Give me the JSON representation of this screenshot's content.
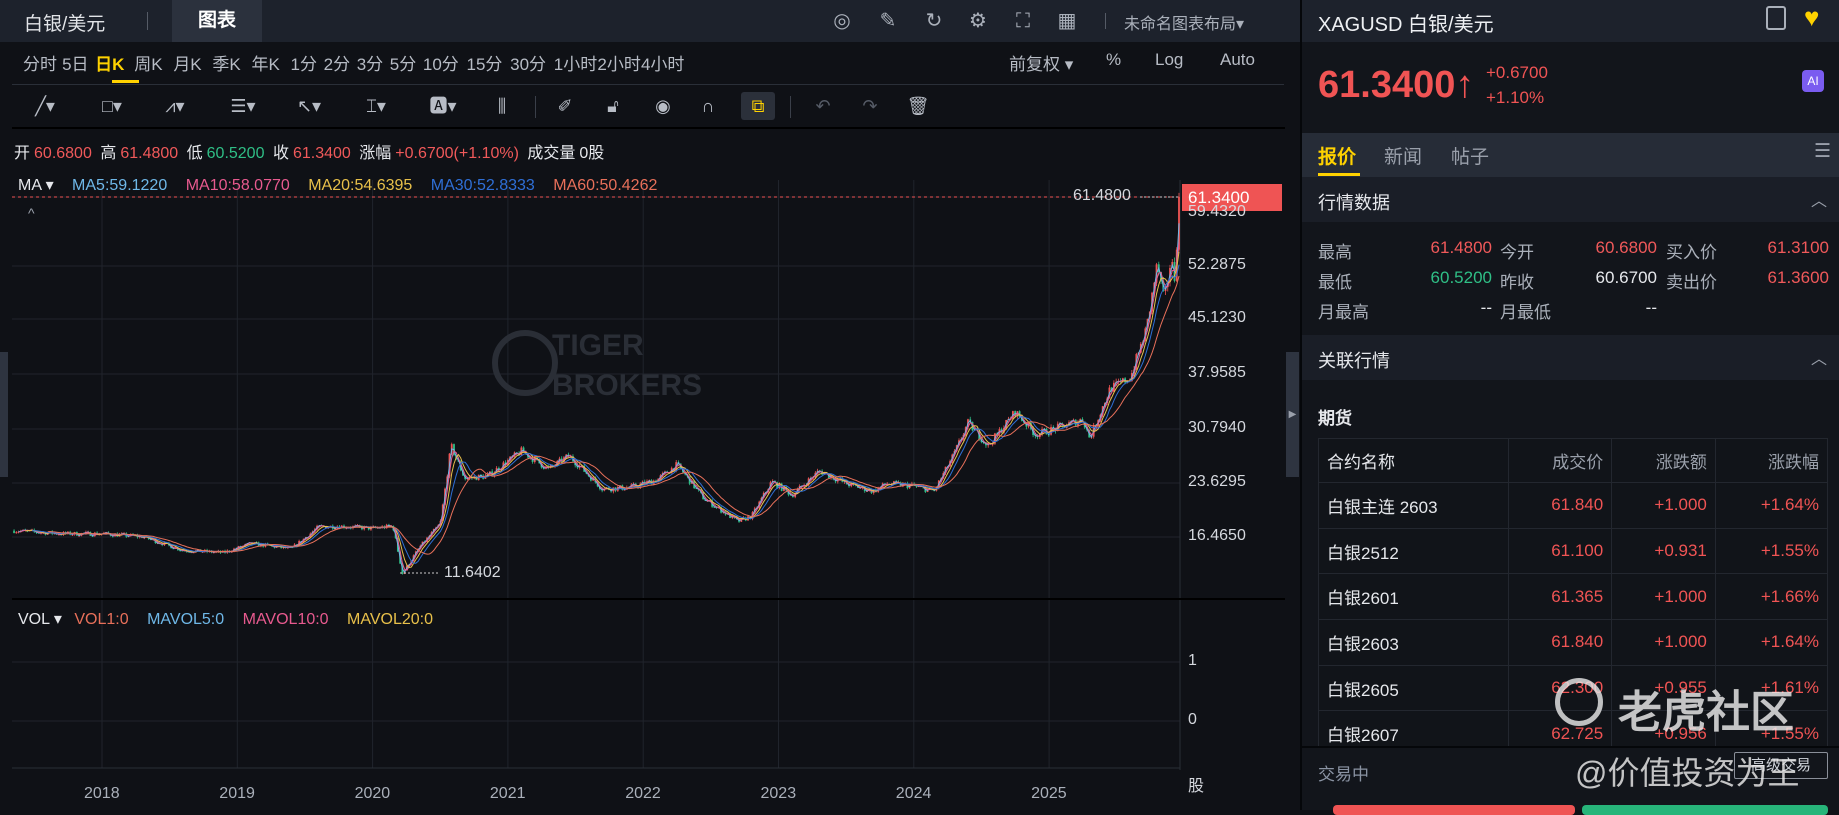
{
  "topbar": {
    "symbol": "白银/美元",
    "tab": "图表",
    "layout": "未命名图表布局▾",
    "icons": [
      "speed-icon",
      "edit-icon",
      "refresh-icon",
      "settings-icon",
      "fullscreen-icon",
      "grid-layout-icon"
    ]
  },
  "timeframes": [
    "分时",
    "5日",
    "日K",
    "周K",
    "月K",
    "季K",
    "年K",
    "1分",
    "2分",
    "3分",
    "5分",
    "10分",
    "15分",
    "30分",
    "1小时",
    "2小时",
    "4小时"
  ],
  "active_timeframe": "日K",
  "chart_options": {
    "adjust": "前复权 ▾",
    "percent": "%",
    "log": "Log",
    "auto": "Auto"
  },
  "ohlc": {
    "open_label": "开",
    "open": "60.6800",
    "high_label": "高",
    "high": "61.4800",
    "low_label": "低",
    "low": "60.5200",
    "close_label": "收",
    "close": "61.3400",
    "change_label": "涨幅",
    "change": "+0.6700(+1.10%)",
    "volume_label": "成交量",
    "volume": "0股"
  },
  "ma_legend": {
    "name": "MA ▾",
    "ma5": "MA5:59.1220",
    "ma10": "MA10:58.0770",
    "ma20": "MA20:54.6395",
    "ma30": "MA30:52.8333",
    "ma60": "MA60:50.4262"
  },
  "vol_legend": {
    "name": "VOL ▾",
    "vol1": "VOL1:0",
    "mavol5": "MAVOL5:0",
    "mavol10": "MAVOL10:0",
    "mavol20": "MAVOL20:0"
  },
  "price_axis": {
    "top_tag": "61.3400",
    "labels": [
      "59.4320",
      "52.2875",
      "45.1230",
      "37.9585",
      "30.7940",
      "23.6295",
      "16.4650"
    ],
    "high_marker": "61.4800",
    "low_marker": "11.6402"
  },
  "vol_axis": {
    "labels": [
      "1",
      "0"
    ],
    "unit": "股"
  },
  "x_axis": {
    "labels": [
      "2018",
      "2019",
      "2020",
      "2021",
      "2022",
      "2023",
      "2024",
      "2025"
    ]
  },
  "watermark_chart": "TIGER BROKERS",
  "price_path": [
    [
      2017.35,
      17.3
    ],
    [
      2017.7,
      16.9
    ],
    [
      2018.0,
      16.9
    ],
    [
      2018.3,
      16.5
    ],
    [
      2018.6,
      14.7
    ],
    [
      2018.9,
      14.4
    ],
    [
      2019.1,
      15.6
    ],
    [
      2019.4,
      14.9
    ],
    [
      2019.6,
      17.8
    ],
    [
      2019.75,
      17.9
    ],
    [
      2020.0,
      17.6
    ],
    [
      2020.15,
      17.9
    ],
    [
      2020.22,
      11.64
    ],
    [
      2020.35,
      15.2
    ],
    [
      2020.5,
      18.2
    ],
    [
      2020.58,
      28.5
    ],
    [
      2020.68,
      24.2
    ],
    [
      2020.85,
      24.5
    ],
    [
      2021.0,
      26.5
    ],
    [
      2021.1,
      27.8
    ],
    [
      2021.3,
      25.4
    ],
    [
      2021.45,
      27.2
    ],
    [
      2021.7,
      22.8
    ],
    [
      2021.9,
      23.0
    ],
    [
      2022.1,
      24.0
    ],
    [
      2022.25,
      26.0
    ],
    [
      2022.45,
      21.5
    ],
    [
      2022.7,
      18.5
    ],
    [
      2022.8,
      19.2
    ],
    [
      2022.95,
      23.8
    ],
    [
      2023.1,
      22.0
    ],
    [
      2023.3,
      25.2
    ],
    [
      2023.5,
      23.5
    ],
    [
      2023.7,
      22.5
    ],
    [
      2023.8,
      23.5
    ],
    [
      2024.0,
      23.2
    ],
    [
      2024.15,
      22.5
    ],
    [
      2024.3,
      27.5
    ],
    [
      2024.4,
      31.5
    ],
    [
      2024.55,
      28.5
    ],
    [
      2024.75,
      33.0
    ],
    [
      2024.9,
      30.0
    ],
    [
      2025.0,
      30.5
    ],
    [
      2025.25,
      32.0
    ],
    [
      2025.3,
      29.5
    ],
    [
      2025.45,
      36.0
    ],
    [
      2025.6,
      37.5
    ],
    [
      2025.72,
      44.0
    ],
    [
      2025.8,
      52.5
    ],
    [
      2025.85,
      47.5
    ],
    [
      2025.9,
      53.0
    ],
    [
      2025.93,
      50.5
    ],
    [
      2025.96,
      61.34
    ]
  ],
  "right": {
    "title": "XAGUSD 白银/美元",
    "price": "61.3400↑",
    "change": "+0.6700",
    "change_pct": "+1.10%",
    "ai_badge": "AI",
    "tabs": [
      "报价",
      "新闻",
      "帖子"
    ],
    "section_quote": "行情数据",
    "quote": {
      "high_label": "最高",
      "high": "61.4800",
      "open_label": "今开",
      "open": "60.6800",
      "bid_label": "买入价",
      "bid": "61.3100",
      "low_label": "最低",
      "low": "60.5200",
      "prev_label": "昨收",
      "prev": "60.6700",
      "ask_label": "卖出价",
      "ask": "61.3600",
      "mhigh_label": "月最高",
      "mhigh": "--",
      "mlow_label": "月最低",
      "mlow": "--"
    },
    "section_related": "关联行情",
    "futures_label": "期货",
    "table_headers": [
      "合约名称",
      "成交价",
      "涨跌额",
      "涨跌幅"
    ],
    "rows": [
      [
        "白银主连 2603",
        "61.840",
        "+1.000",
        "+1.64%"
      ],
      [
        "白银2512",
        "61.100",
        "+0.931",
        "+1.55%"
      ],
      [
        "白银2601",
        "61.365",
        "+1.000",
        "+1.66%"
      ],
      [
        "白银2603",
        "61.840",
        "+1.000",
        "+1.64%"
      ],
      [
        "白银2605",
        "62.300",
        "+0.955",
        "+1.61%"
      ],
      [
        "白银2607",
        "62.725",
        "+0.956",
        "+1.55%"
      ]
    ],
    "status": "交易中",
    "advanced_trade": "高级交易"
  },
  "overlay_watermark": {
    "community": "老虎社区",
    "author": "@价值投资为王"
  },
  "colors": {
    "up": "#f05454",
    "down": "#2fbf86",
    "accent": "#ffd200",
    "ma5": "#6fb8e8",
    "ma10": "#e85a8f",
    "ma20": "#e8c04a",
    "ma30": "#2f6fd6",
    "ma60": "#e8705a"
  }
}
